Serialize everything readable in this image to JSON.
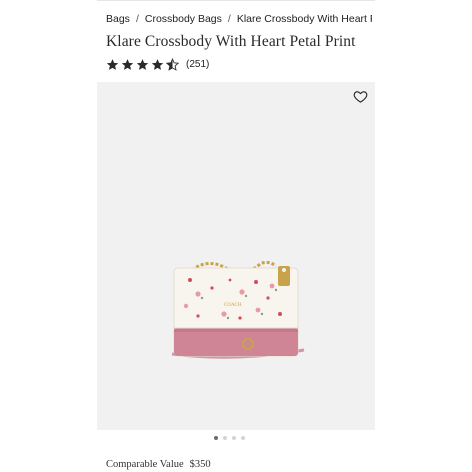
{
  "breadcrumb": {
    "items": [
      "Bags",
      "Crossbody Bags",
      "Klare Crossbody With Heart Petal P"
    ],
    "separator": "/"
  },
  "product": {
    "title": "Klare Crossbody With Heart Petal Print",
    "rating": 4.5,
    "review_count": "(251)",
    "compare_label": "Comparable Value",
    "compare_price": "$350"
  },
  "gallery": {
    "total_images": 4,
    "active_index": 0
  },
  "icons": {
    "wishlist": "heart-outline-icon",
    "star": "star-icon"
  },
  "colors": {
    "star": "#2b2b2b",
    "panel_bg": "#f1f1f1",
    "bag_body": "#f8f5ee",
    "bag_pink": "#cf8595",
    "chain_gold": "#c9a34a",
    "dot_active": "#6b6b6b",
    "dot_inactive": "#d4d4d4"
  }
}
